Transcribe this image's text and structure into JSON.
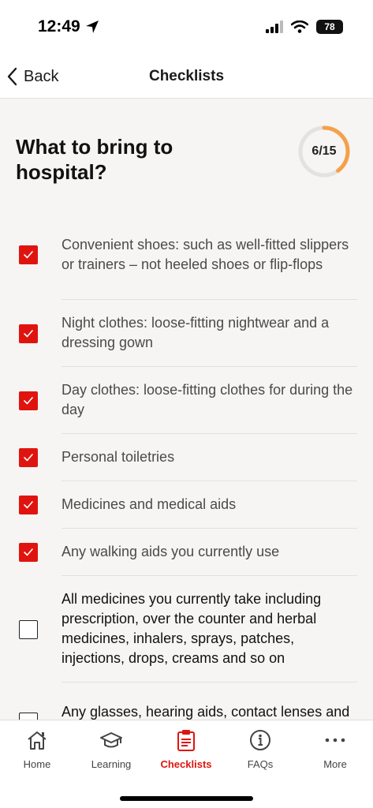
{
  "status": {
    "time": "12:49",
    "battery": "78"
  },
  "nav": {
    "back_label": "Back",
    "title": "Checklists"
  },
  "page": {
    "title": "What to bring to hospital?",
    "progress_label": "6/15",
    "progress_fraction": 0.4
  },
  "items": [
    {
      "label": "Convenient shoes: such as well-fitted slippers or trainers – not heeled shoes or flip-flops",
      "checked": true
    },
    {
      "label": "Night clothes: loose-fitting nightwear and a dressing gown",
      "checked": true
    },
    {
      "label": "Day clothes: loose-fitting clothes for during the day",
      "checked": true
    },
    {
      "label": "Personal toiletries",
      "checked": true
    },
    {
      "label": "Medicines and medical aids",
      "checked": true
    },
    {
      "label": "Any walking aids you currently use",
      "checked": true
    },
    {
      "label": "All medicines you currently take including prescription, over the counter and herbal medicines, inhalers, sprays, patches, injections, drops, creams and so on",
      "checked": false
    },
    {
      "label": "Any glasses, hearing aids, contact lenses and dentures you currently use",
      "checked": false
    }
  ],
  "tabs": [
    {
      "label": "Home",
      "icon": "home-icon",
      "active": false
    },
    {
      "label": "Learning",
      "icon": "graduation-cap-icon",
      "active": false
    },
    {
      "label": "Checklists",
      "icon": "clipboard-icon",
      "active": true
    },
    {
      "label": "FAQs",
      "icon": "info-icon",
      "active": false
    },
    {
      "label": "More",
      "icon": "more-icon",
      "active": false
    }
  ],
  "colors": {
    "accent": "#e0140f",
    "progress": "#f5a04a",
    "ring_track": "#e4e2df"
  }
}
